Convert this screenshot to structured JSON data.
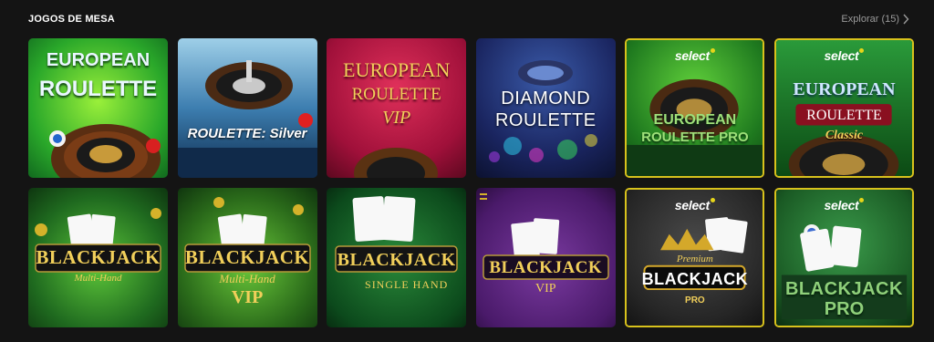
{
  "section": {
    "title": "JOGOS DE MESA",
    "explore_label": "Explorar (15)"
  },
  "games": [
    {
      "lines": [
        "EUROPEAN",
        "ROULETTE"
      ]
    },
    {
      "lines": [
        "ROULETTE: Silver"
      ]
    },
    {
      "lines": [
        "EUROPEAN",
        "ROULETTE",
        "VIP"
      ]
    },
    {
      "lines": [
        "DIAMOND",
        "ROULETTE"
      ]
    },
    {
      "badge": "select",
      "lines": [
        "EUROPEAN",
        "ROULETTE PRO"
      ]
    },
    {
      "badge": "select",
      "lines": [
        "EUROPEAN",
        "ROULETTE",
        "Classic"
      ]
    },
    {
      "lines": [
        "BLACKJACK",
        "Multi-Hand"
      ]
    },
    {
      "lines": [
        "BLACKJACK",
        "Multi-Hand",
        "VIP"
      ]
    },
    {
      "lines": [
        "BLACKJACK",
        "SINGLE HAND"
      ]
    },
    {
      "lines": [
        "BLACKJACK",
        "VIP"
      ]
    },
    {
      "badge": "select",
      "lines": [
        "Premium",
        "BLACKJACK",
        "PRO"
      ]
    },
    {
      "badge": "select",
      "lines": [
        "BLACKJACK",
        "PRO"
      ]
    }
  ],
  "colors": {
    "background": "#141414",
    "select_border": "#d8c21c",
    "gold_text": "#f1cf5a"
  }
}
